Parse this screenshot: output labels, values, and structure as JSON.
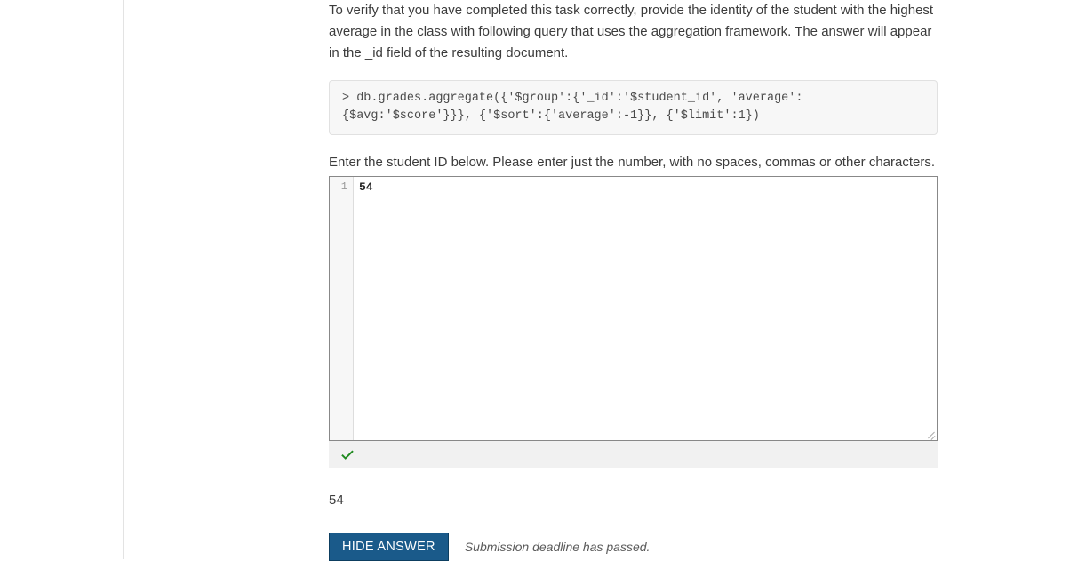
{
  "instruction": "To verify that you have completed this task correctly, provide the identity of the student with the highest average in the class with following query that uses the aggregation framework. The answer will appear in the _id field of the resulting document.",
  "code_snippet": "> db.grades.aggregate({'$group':{'_id':'$student_id', 'average':{$avg:'$score'}}}, {'$sort':{'average':-1}}, {'$limit':1})",
  "prompt_label": "Enter the student ID below. Please enter just the number, with no spaces, commas or other characters.",
  "editor": {
    "line_number": "1",
    "value": "54"
  },
  "answer_output": "54",
  "hide_answer_label": "HIDE ANSWER",
  "deadline_message": "Submission deadline has passed."
}
